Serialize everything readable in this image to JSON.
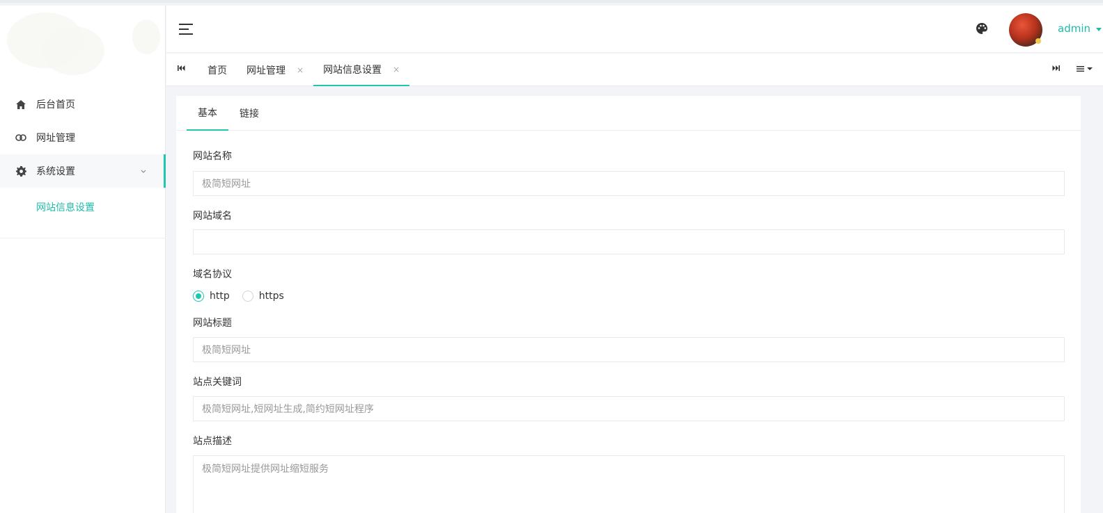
{
  "sidebar": {
    "items": [
      {
        "label": "后台首页",
        "icon": "home-icon"
      },
      {
        "label": "网址管理",
        "icon": "link-icon"
      },
      {
        "label": "系统设置",
        "icon": "gear-icon"
      }
    ],
    "sub_item": "网站信息设置"
  },
  "header": {
    "user_name": "admin"
  },
  "tabs": [
    {
      "label": "首页"
    },
    {
      "label": "网址管理",
      "close": "×"
    },
    {
      "label": "网站信息设置",
      "close": "×"
    }
  ],
  "inner_tabs": [
    "基本",
    "链接"
  ],
  "form": {
    "site_name": {
      "label": "网站名称",
      "value": "极简短网址"
    },
    "site_domain": {
      "label": "网站域名",
      "value": ""
    },
    "protocol": {
      "label": "域名协议",
      "options": [
        "http",
        "https"
      ],
      "selected": "http"
    },
    "site_title": {
      "label": "网站标题",
      "value": "极简短网址"
    },
    "keywords": {
      "label": "站点关键词",
      "value": "极简短网址,短网址生成,简约短网址程序"
    },
    "description": {
      "label": "站点描述",
      "value": "极简短网址提供网址缩短服务"
    }
  },
  "colors": {
    "accent": "#1fc6b0"
  }
}
